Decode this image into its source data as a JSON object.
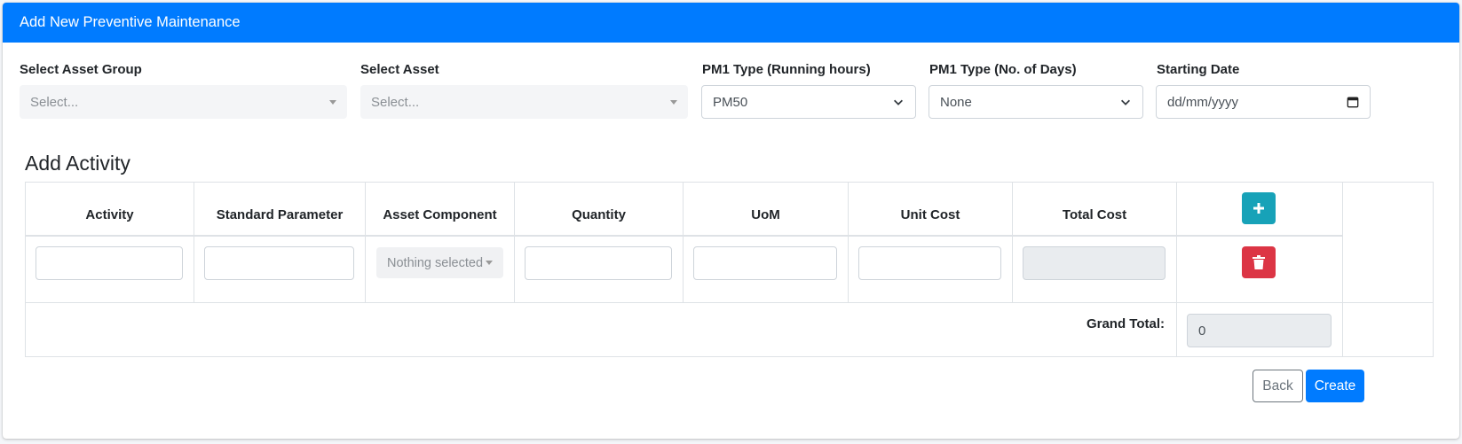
{
  "header": {
    "title": "Add New Preventive Maintenance"
  },
  "form": {
    "asset_group": {
      "label": "Select Asset Group",
      "placeholder": "Select..."
    },
    "asset": {
      "label": "Select Asset",
      "placeholder": "Select..."
    },
    "pm1_running_hours": {
      "label": "PM1 Type (Running hours)",
      "value": "PM50"
    },
    "pm1_days": {
      "label": "PM1 Type (No. of Days)",
      "value": "None"
    },
    "starting_date": {
      "label": "Starting Date",
      "placeholder": "dd/mm/yyyy"
    }
  },
  "activity": {
    "title": "Add Activity",
    "columns": [
      "Activity",
      "Standard Parameter",
      "Asset Component",
      "Quantity",
      "UoM",
      "Unit Cost",
      "Total Cost"
    ],
    "component_placeholder": "Nothing selected",
    "grand_total_label": "Grand Total:",
    "grand_total_value": "0"
  },
  "actions": {
    "back": "Back",
    "create": "Create"
  },
  "colors": {
    "primary": "#007bff",
    "info": "#17a2b8",
    "danger": "#dc3545"
  },
  "icons": {
    "add": "plus-icon",
    "delete": "trash-icon",
    "calendar": "calendar-icon",
    "dropdown": "chevron-down-icon"
  }
}
